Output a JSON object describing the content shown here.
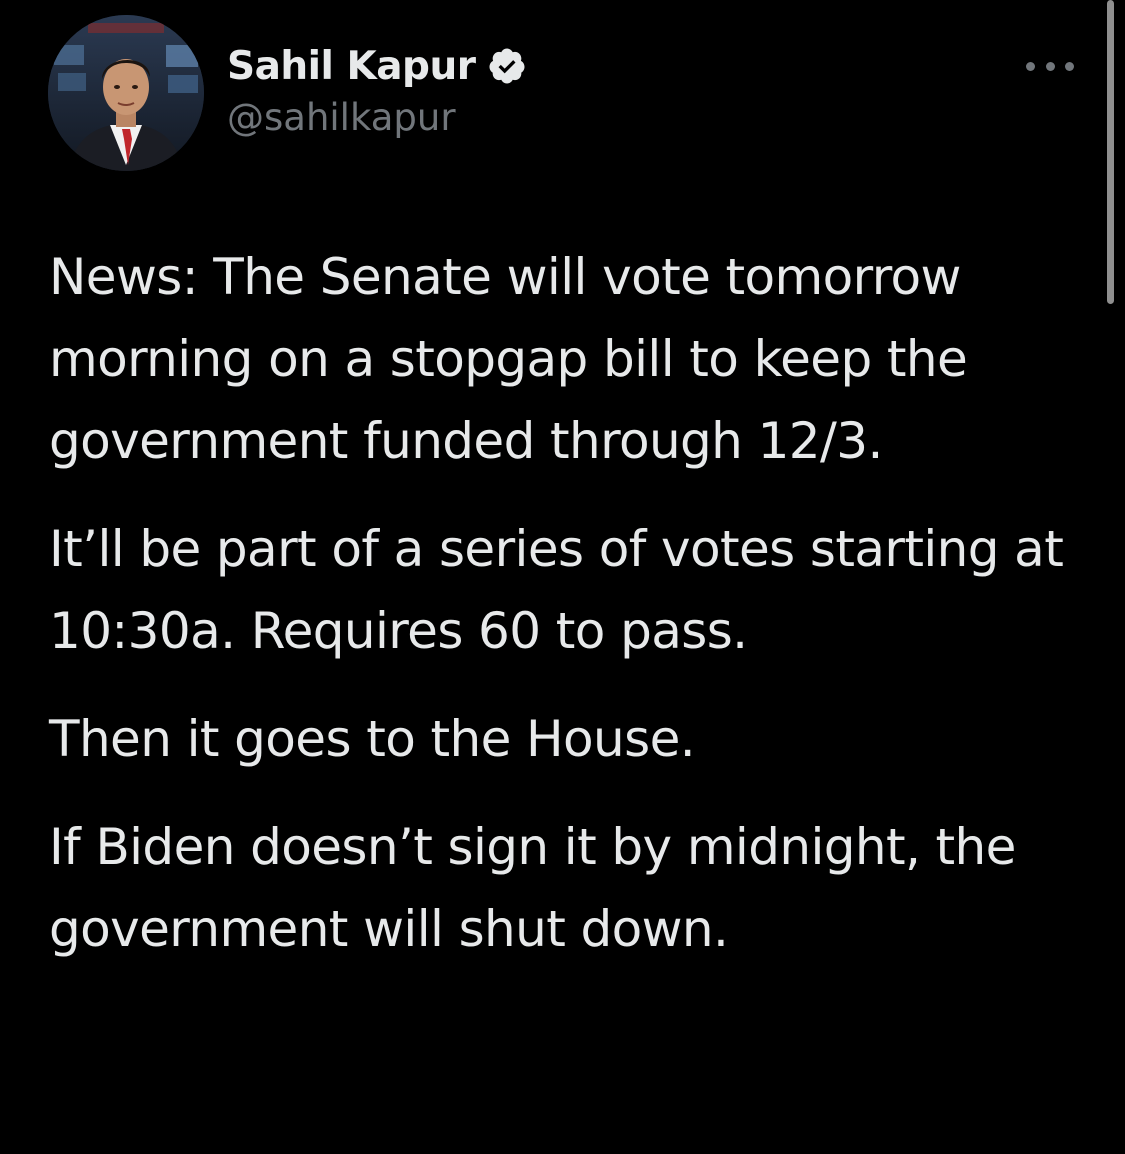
{
  "tweet": {
    "author": {
      "display_name": "Sahil Kapur",
      "handle": "@sahilkapur",
      "verified": true,
      "avatar_icon": "person-avatar"
    },
    "more_icon": "more-horizontal-icon",
    "paragraphs": [
      "News: The Senate will vote tomorrow morning on a stopgap bill to keep the government funded through 12/3.",
      "It’ll be part of a series of votes starting at 10:30a. Requires 60 to pass.",
      "Then it goes to the House.",
      "If Biden doesn’t sign it by midnight, the government will shut down."
    ]
  },
  "colors": {
    "background": "#000000",
    "text_primary": "#e7e9ea",
    "text_secondary": "#71767b",
    "verified_badge": "#e7e9ea"
  }
}
